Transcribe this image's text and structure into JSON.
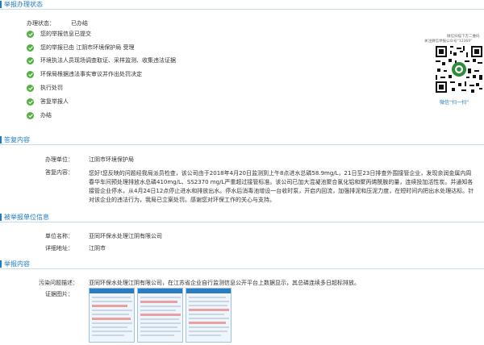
{
  "status_section": {
    "title": "举报办理状态",
    "status_label": "办理状态：",
    "status_value": "已办结",
    "steps": [
      "您的举报信息已提交",
      "您的举报已由 江阴市环境保护局 受理",
      "环境执法人员现场调查取证、采样监测、收集违法证据",
      "环保局根据违法事实审议并作出处罚决定",
      "执行处罚",
      "答复举报人",
      "办结"
    ]
  },
  "qr": {
    "note_line1": "微信扫描下方二维码",
    "note_line2": "关注微信举报公众号“12369”",
    "caption": "微信“扫一扫”"
  },
  "reply_section": {
    "title": "答复内容",
    "unit_label": "办理单位：",
    "unit_value": "江阴市环境保护局",
    "content_label": "答复内容：",
    "content_text": "您好!您反映的问题经我局派员检查，该公司由于2018年4月20日监测到上午8点进水总磷58.9mg/L，21日至23日排查外围接管企业，发现余润金属内周春华车间预处理排放水总磷410mg/L、SS2370 mg/L严重超过接管标准。该公司已加大混凝池聚合氯化铝和聚丙烯酰胺的量，连续投加活性炭。并通知各接管企业停水，从4月24日12点停止进水和排放出水。停水后消毒池增设一台收时泵，开启内回流，加强排泥和压泥力度，在短时间内把出水处理达标。针对该企业的违法行为，我局已立案处罚。感谢您对环保工作的关心与支持。"
  },
  "reported_section": {
    "title": "被举报单位信息",
    "name_label": "单位名称：",
    "name_value": "亚同环保水处理江阴有限公司",
    "address_label": "详细地址：",
    "address_value": "江阴市"
  },
  "report_section": {
    "title": "举报内容",
    "desc_label": "污染问题描述：",
    "desc_value": "亚同环保水处理江阴有限公司，在江苏省企业自行监测信息公开平台上数据显示，其总磷连续多日超标排放。",
    "evidence_label": "证据图片："
  },
  "colors": {
    "accent": "#1f7bc1",
    "check": "#52b140"
  }
}
